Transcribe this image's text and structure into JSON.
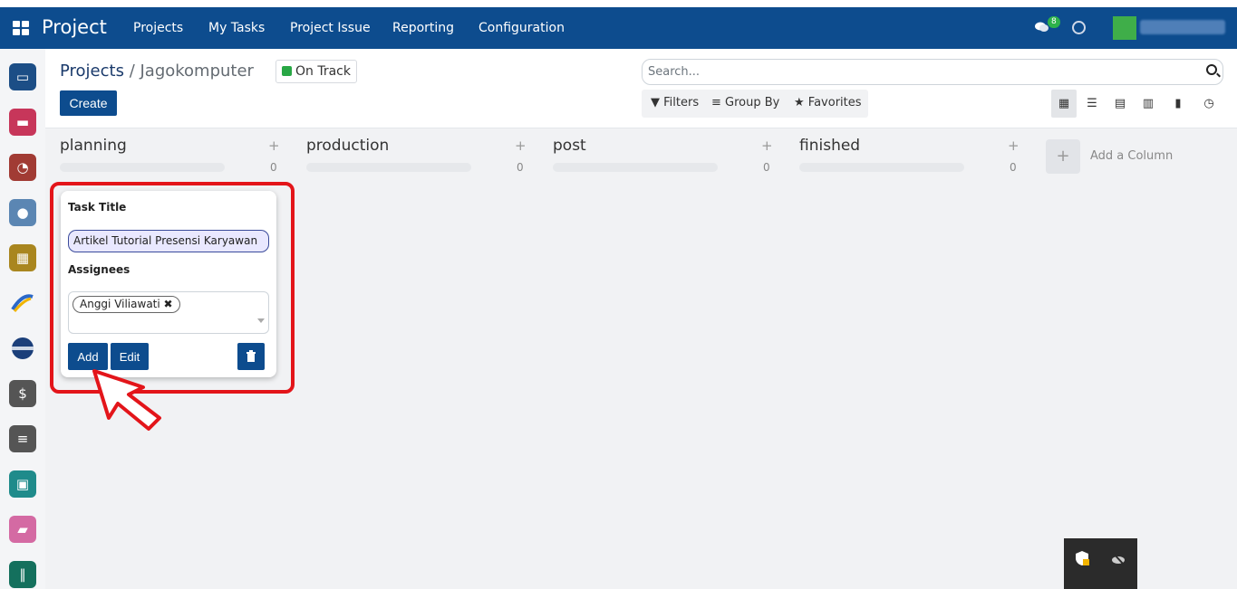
{
  "topbar": {
    "brand": "Project",
    "menu": [
      "Projects",
      "My Tasks",
      "Project Issue",
      "Reporting",
      "Configuration"
    ],
    "chat_badge": "8"
  },
  "rail_icons": [
    "presentation-icon",
    "chat-icon",
    "stopwatch-icon",
    "user-clock-icon",
    "calendar-icon",
    "swoosh-logo-icon",
    "badge-logo-icon",
    "user-dollar-icon",
    "edit-list-icon",
    "contact-card-icon",
    "flow-icon",
    "kanban-icon"
  ],
  "control_panel": {
    "breadcrumb_root": "Projects",
    "breadcrumb_sep": " / ",
    "breadcrumb_current": "Jagokomputer",
    "status_label": "On Track",
    "status_color": "#28a745",
    "create_label": "Create",
    "search_placeholder": "Search...",
    "filters_label": "Filters",
    "group_by_label": "Group By",
    "favorites_label": "Favorites"
  },
  "columns": [
    {
      "title": "planning",
      "count": "0"
    },
    {
      "title": "production",
      "count": "0"
    },
    {
      "title": "post",
      "count": "0"
    },
    {
      "title": "finished",
      "count": "0"
    }
  ],
  "add_column_label": "Add a Column",
  "quick_create": {
    "title_label": "Task Title",
    "title_value": "Artikel Tutorial Presensi Karyawan",
    "assignees_label": "Assignees",
    "assignee_tag": "Anggi Viliawati",
    "add_label": "Add",
    "edit_label": "Edit"
  },
  "colors": {
    "brand": "#0d4c8e",
    "highlight": "#e3151a"
  }
}
